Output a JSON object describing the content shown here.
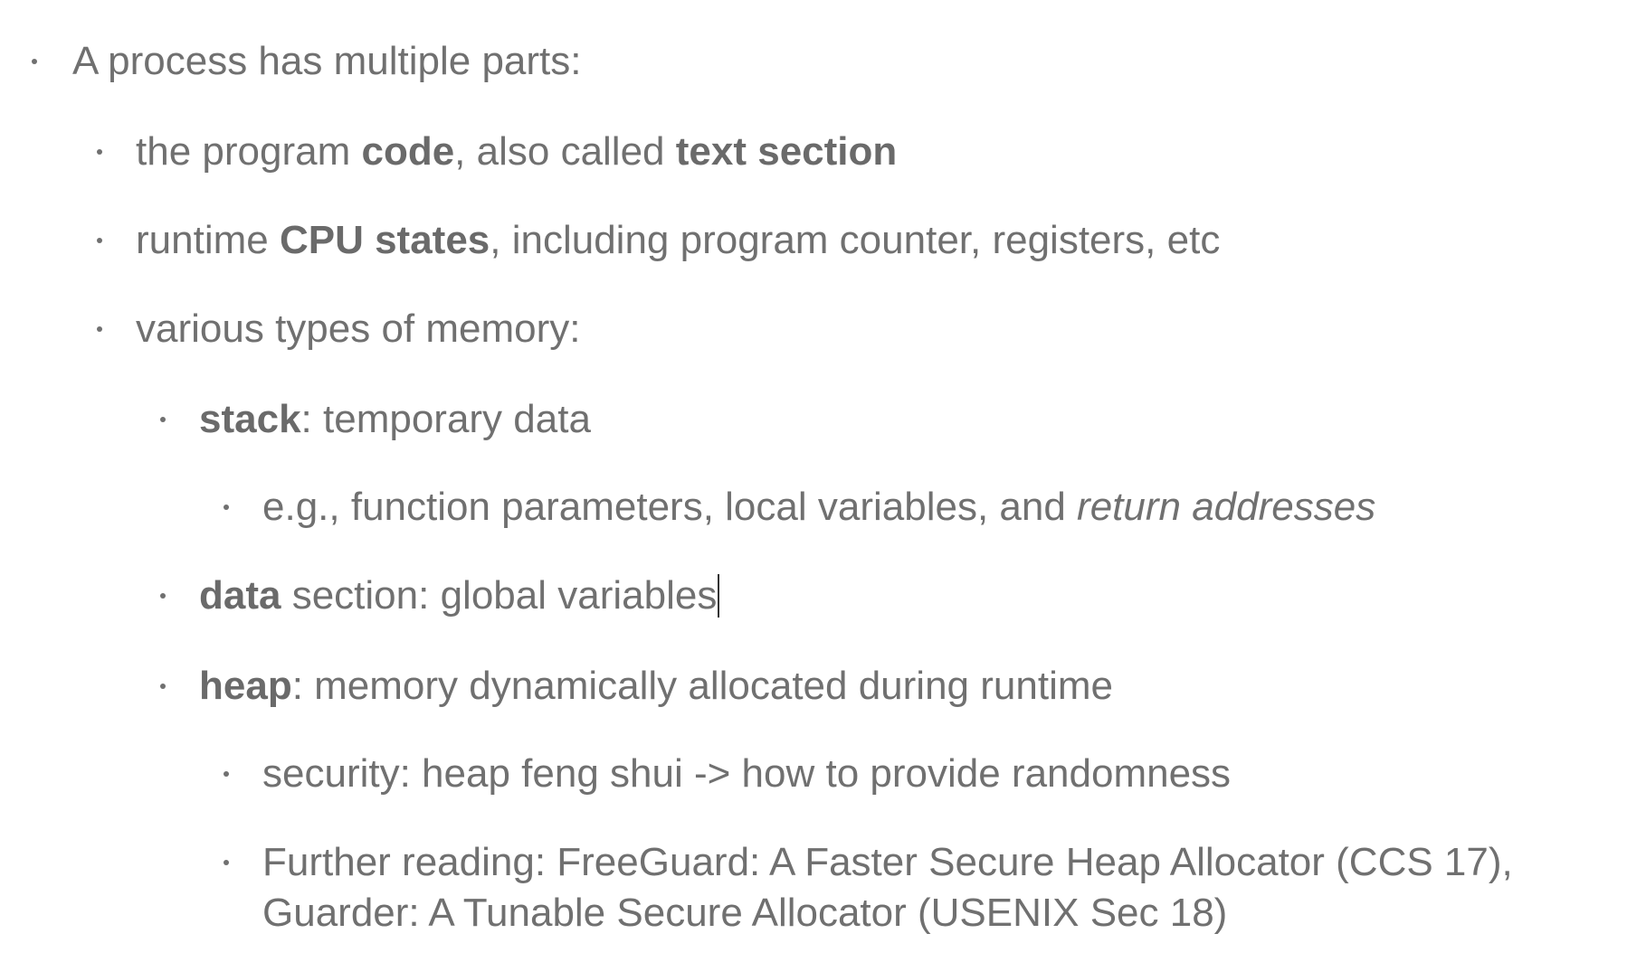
{
  "bullets": {
    "b1": {
      "text": "A process has multiple parts:"
    },
    "b2": {
      "pre": "the program ",
      "bold1": "code",
      "mid": ", also called ",
      "bold2": "text section"
    },
    "b3": {
      "pre": "runtime ",
      "bold": "CPU states",
      "post": ", including program counter, registers, etc"
    },
    "b4": {
      "text": "various types of memory:"
    },
    "b5": {
      "bold": "stack",
      "post": ": temporary data"
    },
    "b6": {
      "pre": "e.g., function parameters, local variables, and ",
      "italic": "return addresses"
    },
    "b7": {
      "bold": "data",
      "post": " section: global variables"
    },
    "b8": {
      "bold": "heap",
      "post": ": memory dynamically allocated during runtime"
    },
    "b9": {
      "text": "security: heap feng shui -> how to provide randomness"
    },
    "b10": {
      "line1": "Further reading: FreeGuard: A Faster Secure Heap Allocator (CCS 17),",
      "line2": "Guarder: A Tunable Secure Allocator (USENIX Sec 18)"
    }
  },
  "colors": {
    "text": "#707070",
    "bold_text": "#6a6a6a",
    "caret": "#333333"
  }
}
